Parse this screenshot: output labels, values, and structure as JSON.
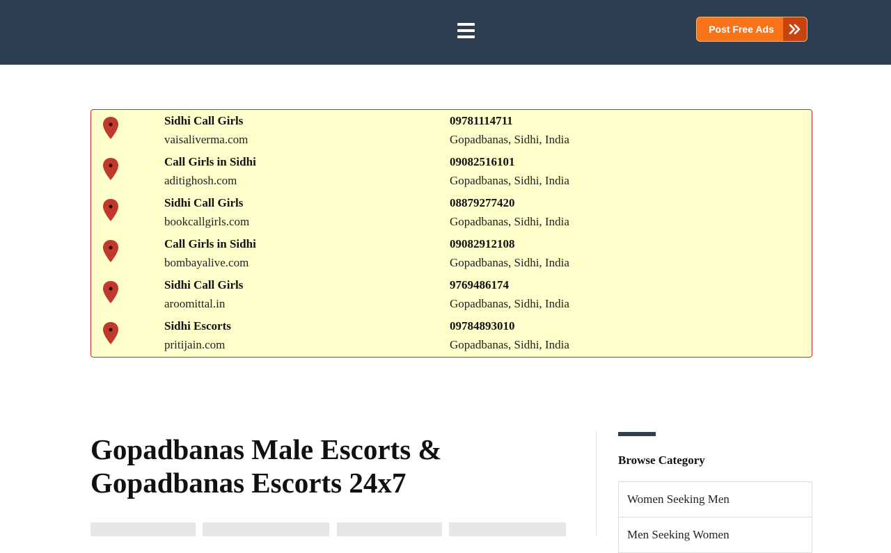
{
  "header": {
    "menu_icon": "hamburger-menu-icon",
    "post_button_label": "Post Free Ads",
    "post_button_icon": "double-chevron-right-icon",
    "colors": {
      "background": "#2d3e50",
      "button": "#f7741b",
      "button_arrow": "#c8430e"
    }
  },
  "listings": [
    {
      "name": "Sidhi Call Girls",
      "site": "vaisaliverma.com",
      "phone": "09781114711",
      "location": "Gopadbanas, Sidhi, India"
    },
    {
      "name": "Call Girls in Sidhi",
      "site": "aditighosh.com",
      "phone": "09082516101",
      "location": "Gopadbanas, Sidhi, India"
    },
    {
      "name": "Sidhi Call Girls",
      "site": "bookcallgirls.com",
      "phone": "08879277420",
      "location": "Gopadbanas, Sidhi, India"
    },
    {
      "name": "Call Girls in Sidhi",
      "site": "bombayalive.com",
      "phone": "09082912108",
      "location": "Gopadbanas, Sidhi, India"
    },
    {
      "name": "Sidhi Call Girls",
      "site": "aroomittal.in",
      "phone": "9769486174",
      "location": "Gopadbanas, Sidhi, India"
    },
    {
      "name": "Sidhi Escorts",
      "site": "pritijain.com",
      "phone": "09784893010",
      "location": "Gopadbanas, Sidhi, India"
    }
  ],
  "listing_icon": "map-pin-icon",
  "main": {
    "title_line1": "Gopadbanas Male Escorts &",
    "title_line2": "Gopadbanas Escorts 24x7"
  },
  "sidebar": {
    "heading": "Browse Category",
    "categories": [
      "Women Seeking Men",
      "Men Seeking Women"
    ]
  }
}
